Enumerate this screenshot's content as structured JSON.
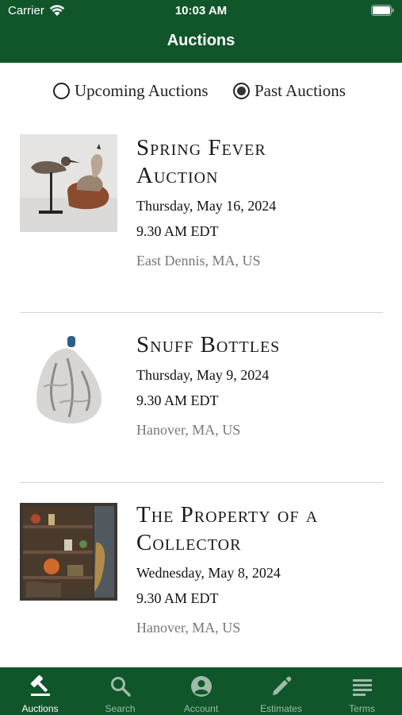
{
  "status_bar": {
    "carrier": "Carrier",
    "time": "10:03 AM"
  },
  "nav": {
    "title": "Auctions"
  },
  "filter": {
    "options": [
      {
        "label": "Upcoming Auctions",
        "selected": false
      },
      {
        "label": "Past Auctions",
        "selected": true
      }
    ]
  },
  "auctions": [
    {
      "title_line1": "Spring Fever",
      "title_line2": "Auction",
      "date": "Thursday, May 16, 2024",
      "time": "9.30 AM EDT",
      "location": "East Dennis, MA, US"
    },
    {
      "title_line1": "Snuff Bottles",
      "title_line2": "",
      "date": "Thursday, May 9, 2024",
      "time": "9.30 AM EDT",
      "location": "Hanover, MA, US"
    },
    {
      "title_line1": "The Property of a",
      "title_line2": "Collector",
      "date": "Wednesday, May 8, 2024",
      "time": "9.30 AM EDT",
      "location": "Hanover, MA, US"
    }
  ],
  "tabs": [
    {
      "label": "Auctions",
      "icon": "gavel-icon",
      "active": true
    },
    {
      "label": "Search",
      "icon": "search-icon",
      "active": false
    },
    {
      "label": "Account",
      "icon": "account-icon",
      "active": false
    },
    {
      "label": "Estimates",
      "icon": "pencil-icon",
      "active": false
    },
    {
      "label": "Terms",
      "icon": "list-icon",
      "active": false
    }
  ],
  "colors": {
    "brand_green": "#11562b",
    "tab_inactive": "#9fbba8"
  }
}
